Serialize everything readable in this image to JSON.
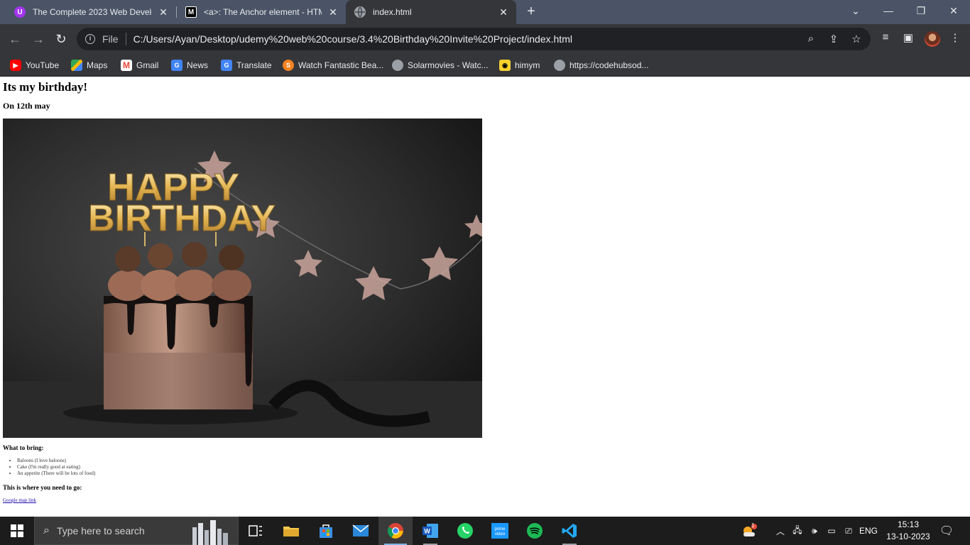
{
  "tabs": [
    {
      "title": "The Complete 2023 Web Develo",
      "favicon": "udemy-icon",
      "color": "#a435f0"
    },
    {
      "title": "<a>: The Anchor element - HTM",
      "favicon": "mdn-icon",
      "color": "#000000"
    },
    {
      "title": "index.html",
      "favicon": "globe-icon",
      "color": "#5f6368"
    }
  ],
  "address": {
    "file_label": "File",
    "url": "C:/Users/Ayan/Desktop/udemy%20web%20course/3.4%20Birthday%20Invite%20Project/index.html"
  },
  "bookmarks": [
    {
      "label": "YouTube",
      "icon": "youtube-icon"
    },
    {
      "label": "Maps",
      "icon": "maps-icon"
    },
    {
      "label": "Gmail",
      "icon": "gmail-icon"
    },
    {
      "label": "News",
      "icon": "news-icon"
    },
    {
      "label": "Translate",
      "icon": "translate-icon"
    },
    {
      "label": "Watch Fantastic Bea...",
      "icon": "s-icon"
    },
    {
      "label": "Solarmovies - Watc...",
      "icon": "globe-icon"
    },
    {
      "label": "himym",
      "icon": "himym-icon"
    },
    {
      "label": "https://codehubsod...",
      "icon": "globe-icon"
    }
  ],
  "page": {
    "heading": "Its my birthday!",
    "subheading": "On 12th may",
    "image_text": "HAPPY BIRTHDAY",
    "bring_heading": "What to bring:",
    "bring_items": [
      "Baloons (I love baloons)",
      "Cake (I'm really good at eating)",
      "An appetite (There will be lots of food)"
    ],
    "where_heading": "This is where you need to go:",
    "link_text": "Google map link"
  },
  "taskbar": {
    "search_placeholder": "Type here to search",
    "language": "ENG",
    "time": "15:13",
    "date": "13-10-2023",
    "notification_badge": "1"
  }
}
